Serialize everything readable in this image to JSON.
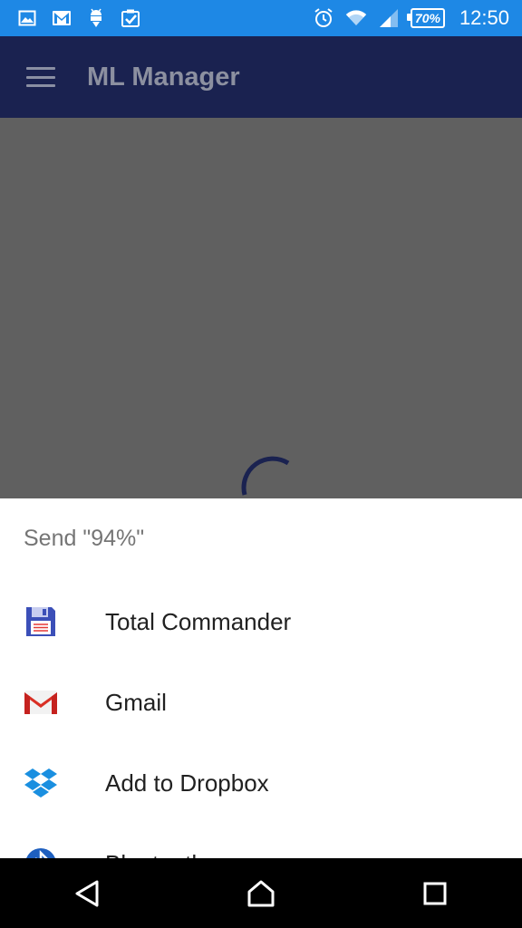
{
  "status_bar": {
    "notification_icons": [
      "gallery-icon",
      "gmail-icon",
      "android-download-icon",
      "clipboard-check-icon"
    ],
    "system_icons": [
      "alarm-icon",
      "wifi-icon",
      "signal-icon"
    ],
    "battery_level": "70%",
    "time": "12:50",
    "background": "#1e88e5"
  },
  "app_bar": {
    "menu_icon": "hamburger-icon",
    "title": "ML Manager",
    "background": "#1a2250"
  },
  "loading": {
    "icon": "progress-spinner-icon",
    "color": "#1a2250"
  },
  "share_sheet": {
    "title": "Send \"94%\"",
    "items": [
      {
        "label": "Total Commander",
        "icon": "floppy-disk-icon"
      },
      {
        "label": "Gmail",
        "icon": "gmail-icon"
      },
      {
        "label": "Add to Dropbox",
        "icon": "dropbox-icon"
      },
      {
        "label": "Bluetooth",
        "icon": "bluetooth-icon"
      }
    ]
  },
  "nav_bar": {
    "buttons": [
      "back-icon",
      "home-icon",
      "recents-icon"
    ]
  }
}
